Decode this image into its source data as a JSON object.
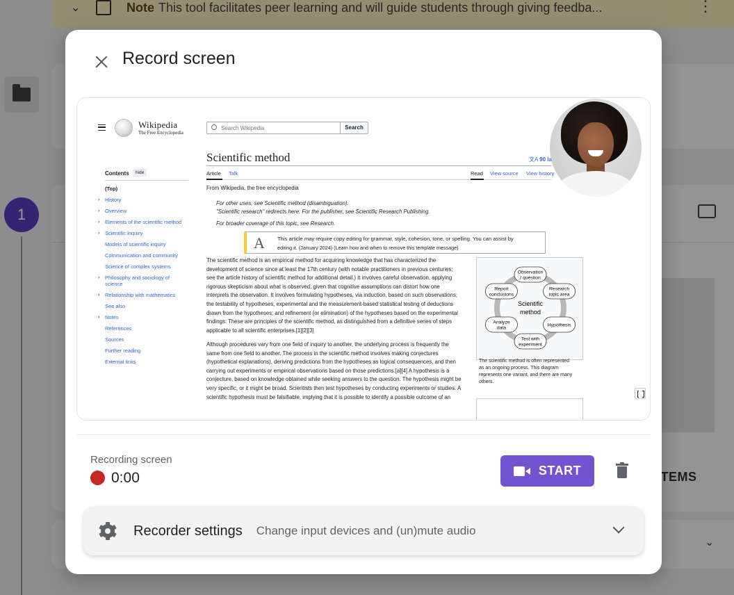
{
  "background": {
    "note_label": "Note",
    "note_text": "This tool facilitates peer learning and will guide students through giving feedba...",
    "step_number": "1",
    "items_label": "ITEMS"
  },
  "dialog": {
    "title": "Record screen",
    "recording_label": "Recording screen",
    "timer": "0:00",
    "start_label": "START",
    "settings_title": "Recorder settings",
    "settings_subtitle": "Change input devices and (un)mute audio"
  },
  "preview": {
    "site_name": "Wikipedia",
    "site_tagline": "The Free Encyclopedia",
    "search_placeholder": "Search Wikipedia",
    "search_button": "Search",
    "article_title": "Scientific method",
    "languages": "90 la",
    "tab_article": "Article",
    "tab_talk": "Talk",
    "tab_read": "Read",
    "tab_view_source": "View source",
    "tab_view_history": "View history",
    "from_line": "From Wikipedia, the free encyclopedia",
    "hat1": "For other uses, see Scientific method (disambiguation).",
    "hat2": "\"Scientific research\" redirects here. For the publisher, see Scientific Research Publishing.",
    "hat3": "For broader coverage of this topic, see Research.",
    "notice_line1": "This article may require copy editing for grammar, style, cohesion, tone, or spelling. You can assist by",
    "notice_line2": "editing it. (January 2024) (Learn how and when to remove this template message)",
    "contents_heading": "Contents",
    "hide_label": "hide",
    "toc": [
      "(Top)",
      "History",
      "Overview",
      "Elements of the scientific method",
      "Scientific inquiry",
      "Models of scientific inquiry",
      "Communication and community",
      "Science of complex systems",
      "Philosophy and sociology of",
      "science",
      "Relationship with mathematics",
      "See also",
      "Notes",
      "References",
      "Sources",
      "Further reading",
      "External links"
    ],
    "para1": [
      "The scientific method is an empirical method for acquiring knowledge that has characterized the",
      "development of science since at least the 17th century (with notable practitioners in previous centuries;",
      "see the article history of scientific method for additional detail.) It involves careful observation, applying",
      "rigorous skepticism about what is observed, given that cognitive assumptions can distort how one",
      "interprets the observation. It involves formulating hypotheses, via induction, based on such observations;",
      "the testability of hypotheses, experimental and the measurement-based statistical testing of deductions",
      "drawn from the hypotheses; and refinement (or elimination) of the hypotheses based on the experimental",
      "findings. These are principles of the scientific method, as distinguished from a definitive series of steps",
      "applicable to all scientific enterprises.[1][2][3]"
    ],
    "para2": [
      "Although procedures vary from one field of inquiry to another, the underlying process is frequently the",
      "same from one field to another. The process in the scientific method involves making conjectures",
      "(hypothetical explanations), deriving predictions from the hypotheses as logical consequences, and then",
      "carrying out experiments or empirical observations based on those predictions.[a][4] A hypothesis is a",
      "conjecture, based on knowledge obtained while seeking answers to the question. The hypothesis might be",
      "very specific, or it might be broad. Scientists then test hypotheses by conducting experiments or studies. A",
      "scientific hypothesis must be falsifiable, implying that it is possible to identify a possible outcome of an"
    ],
    "diagram": {
      "center": [
        "Scientific",
        "method"
      ],
      "nodes": [
        [
          "Observation",
          "/ question"
        ],
        [
          "Research",
          "topic area"
        ],
        [
          "Hypothesis"
        ],
        [
          "Test with",
          "experiment"
        ],
        [
          "Analyze",
          "data"
        ],
        [
          "Report",
          "conclusions"
        ]
      ]
    },
    "caption": [
      "The scientific method is often represented",
      "as an ongoing process. This diagram",
      "represents one variant, and there are many",
      "others."
    ]
  }
}
